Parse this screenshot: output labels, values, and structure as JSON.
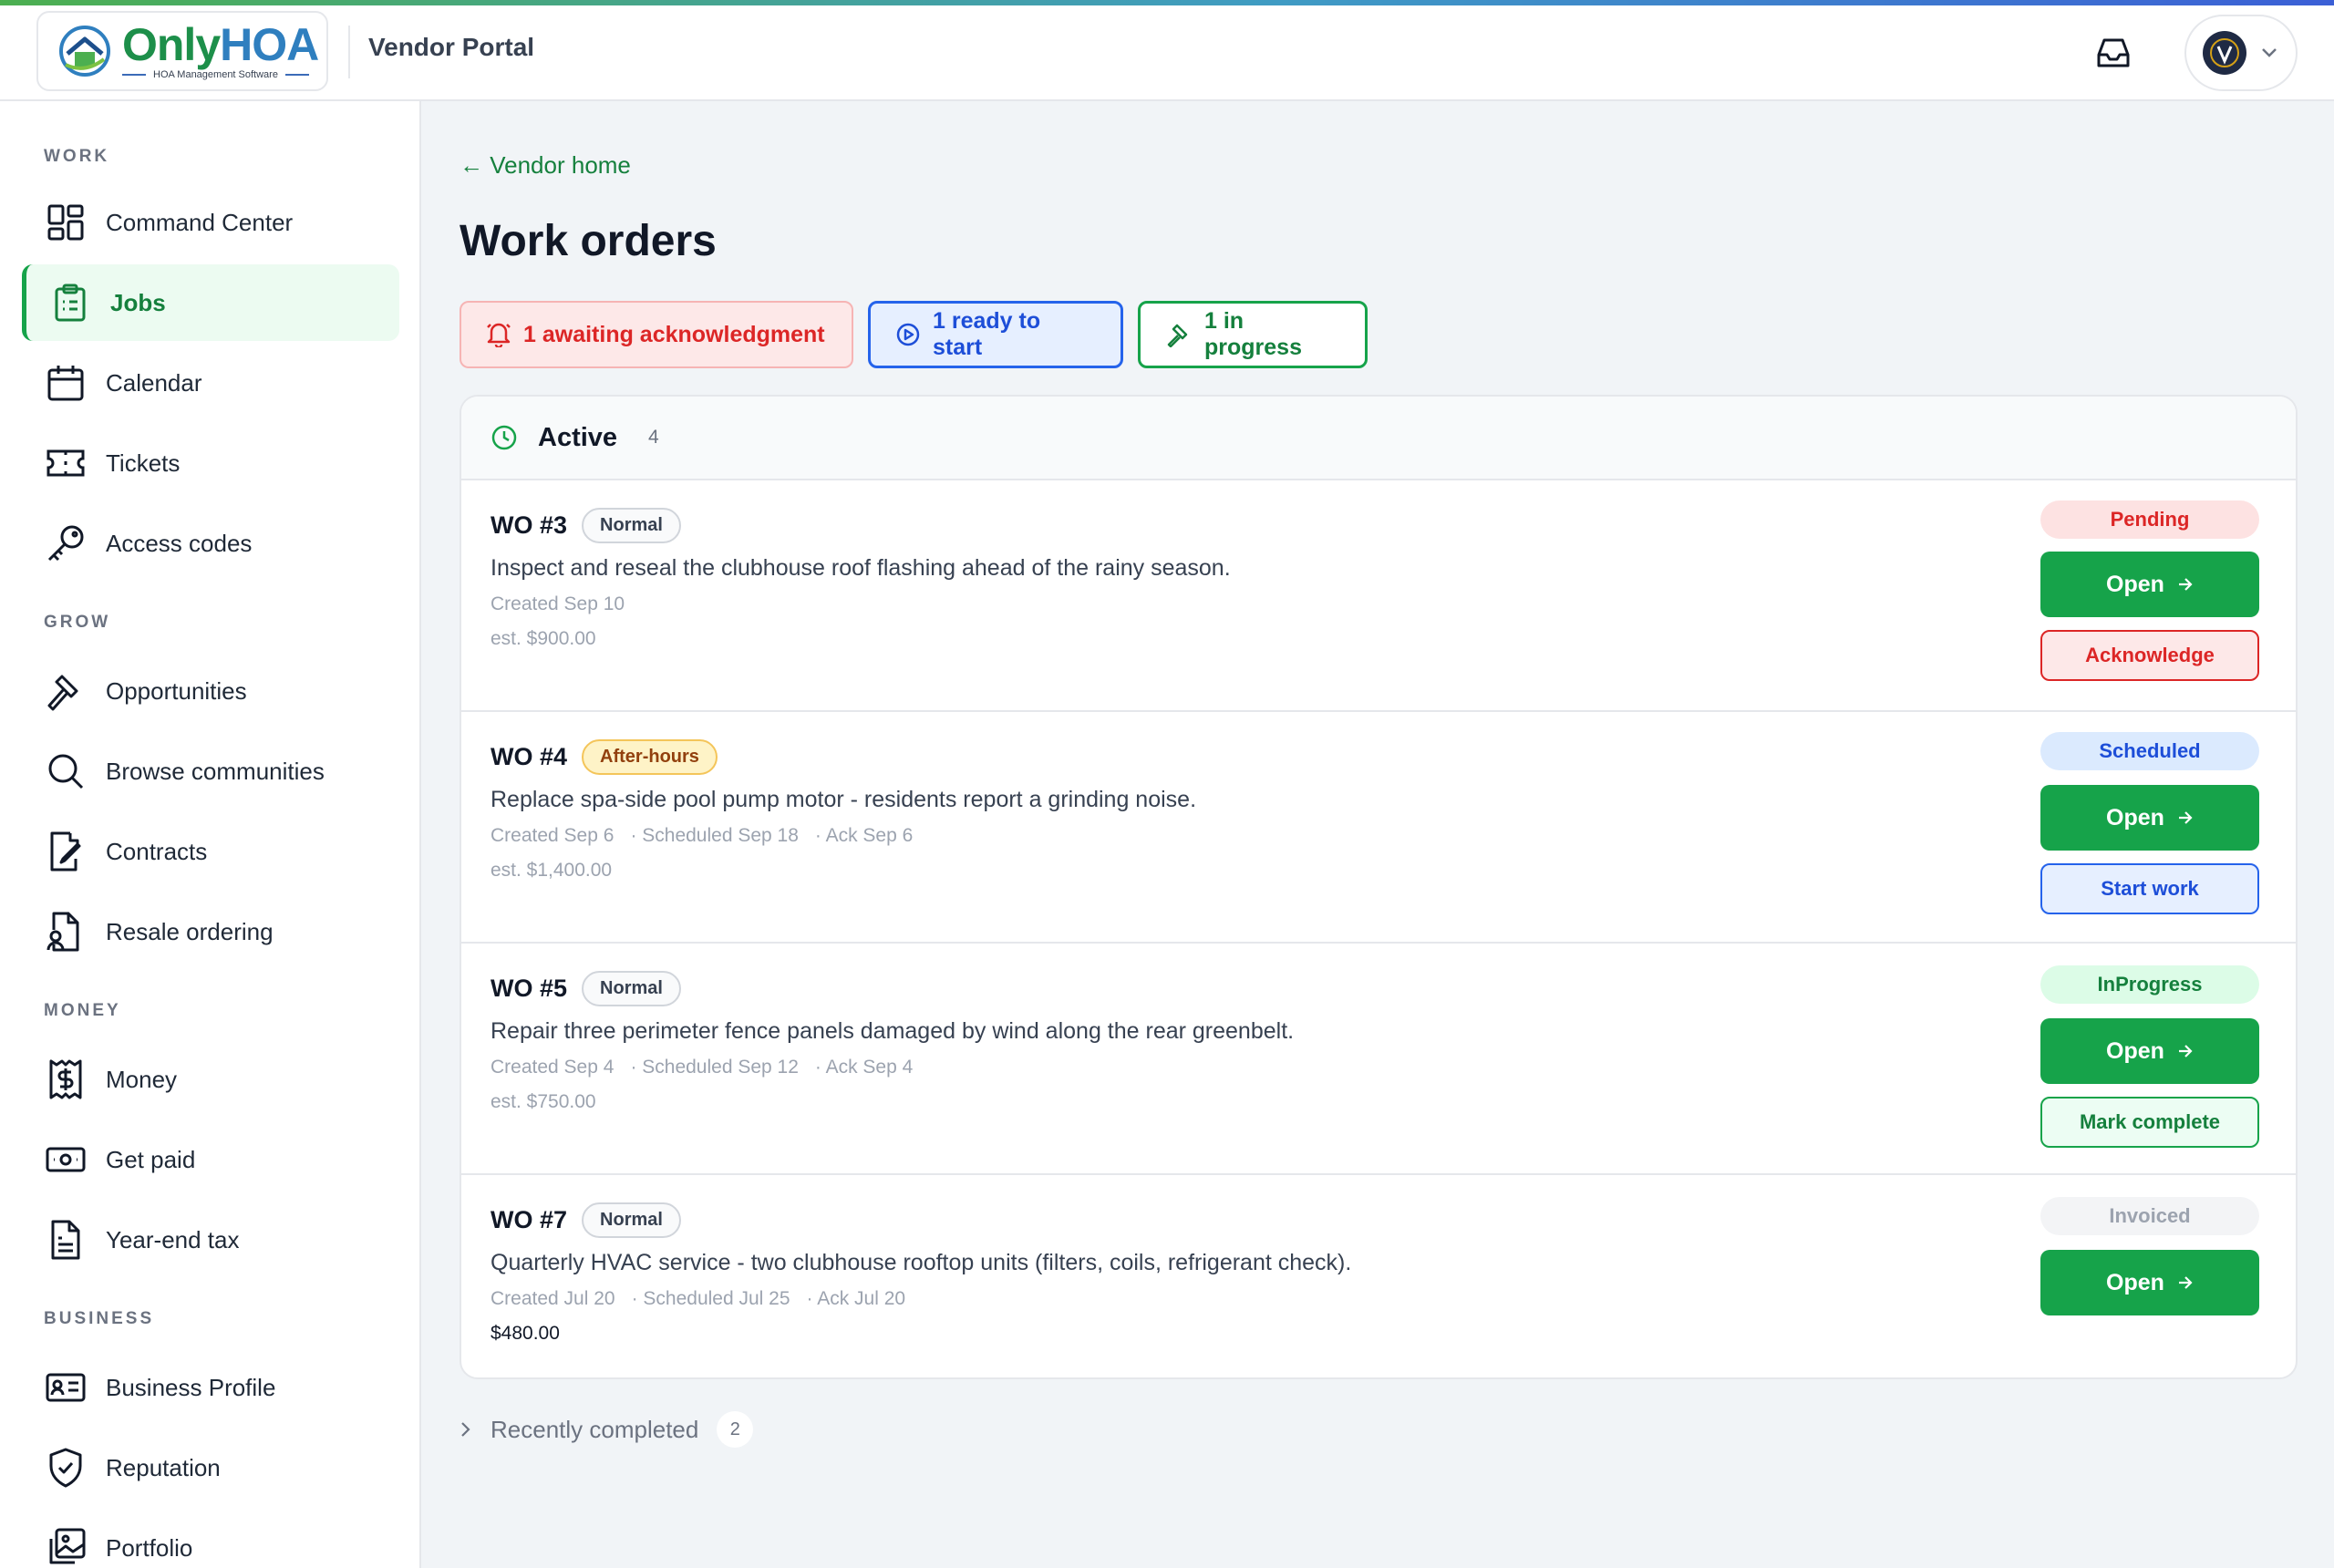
{
  "header": {
    "logo_only": "Only",
    "logo_hoa": "HOA",
    "logo_tagline": "HOA Management Software",
    "portal_title": "Vendor Portal"
  },
  "sidebar": {
    "sections": [
      {
        "label": "WORK",
        "items": [
          {
            "label": "Command Center",
            "icon": "grid-icon"
          },
          {
            "label": "Jobs",
            "icon": "clipboard-icon",
            "active": true
          },
          {
            "label": "Calendar",
            "icon": "calendar-icon"
          },
          {
            "label": "Tickets",
            "icon": "ticket-icon"
          },
          {
            "label": "Access codes",
            "icon": "key-icon"
          }
        ]
      },
      {
        "label": "GROW",
        "items": [
          {
            "label": "Opportunities",
            "icon": "gavel-icon"
          },
          {
            "label": "Browse communities",
            "icon": "search-icon"
          },
          {
            "label": "Contracts",
            "icon": "file-signature-icon"
          },
          {
            "label": "Resale ordering",
            "icon": "file-user-icon"
          }
        ]
      },
      {
        "label": "MONEY",
        "items": [
          {
            "label": "Money",
            "icon": "receipt-dollar-icon"
          },
          {
            "label": "Get paid",
            "icon": "banknote-icon"
          },
          {
            "label": "Year-end tax",
            "icon": "file-text-icon"
          }
        ]
      },
      {
        "label": "BUSINESS",
        "items": [
          {
            "label": "Business Profile",
            "icon": "id-card-icon"
          },
          {
            "label": "Reputation",
            "icon": "shield-check-icon"
          },
          {
            "label": "Portfolio",
            "icon": "images-icon"
          }
        ]
      }
    ]
  },
  "main": {
    "back_link": "← Vendor home",
    "title": "Work orders",
    "chips": {
      "awaiting": "1 awaiting acknowledgment",
      "ready": "1 ready to start",
      "in_progress": "1 in progress"
    },
    "active_card": {
      "title": "Active",
      "count": "4",
      "orders": [
        {
          "number": "WO #3",
          "priority": "Normal",
          "description": "Inspect and reseal the clubhouse roof flashing ahead of the rainy season.",
          "created": "Created Sep 10",
          "scheduled": "",
          "ack": "",
          "estimate": "est. $900.00",
          "status": "Pending",
          "open_label": "Open",
          "secondary_label": "Acknowledge"
        },
        {
          "number": "WO #4",
          "priority": "After-hours",
          "description": "Replace spa-side pool pump motor - residents report a grinding noise.",
          "created": "Created Sep 6",
          "scheduled": "· Scheduled Sep 18",
          "ack": "· Ack Sep 6",
          "estimate": "est. $1,400.00",
          "status": "Scheduled",
          "open_label": "Open",
          "secondary_label": "Start work"
        },
        {
          "number": "WO #5",
          "priority": "Normal",
          "description": "Repair three perimeter fence panels damaged by wind along the rear greenbelt.",
          "created": "Created Sep 4",
          "scheduled": "· Scheduled Sep 12",
          "ack": "· Ack Sep 4",
          "estimate": "est. $750.00",
          "status": "InProgress",
          "open_label": "Open",
          "secondary_label": "Mark complete"
        },
        {
          "number": "WO #7",
          "priority": "Normal",
          "description": "Quarterly HVAC service - two clubhouse rooftop units (filters, coils, refrigerant check).",
          "created": "Created Jul 20",
          "scheduled": "· Scheduled Jul 25",
          "ack": "· Ack Jul 20",
          "estimate": "$480.00",
          "status": "Invoiced",
          "open_label": "Open",
          "secondary_label": ""
        }
      ]
    },
    "recently_completed": {
      "label": "Recently completed",
      "count": "2"
    }
  },
  "colors": {
    "brand_green": "#16a34a",
    "brand_blue": "#2f7fbf",
    "danger": "#dc2626",
    "info": "#1d4ed8"
  }
}
